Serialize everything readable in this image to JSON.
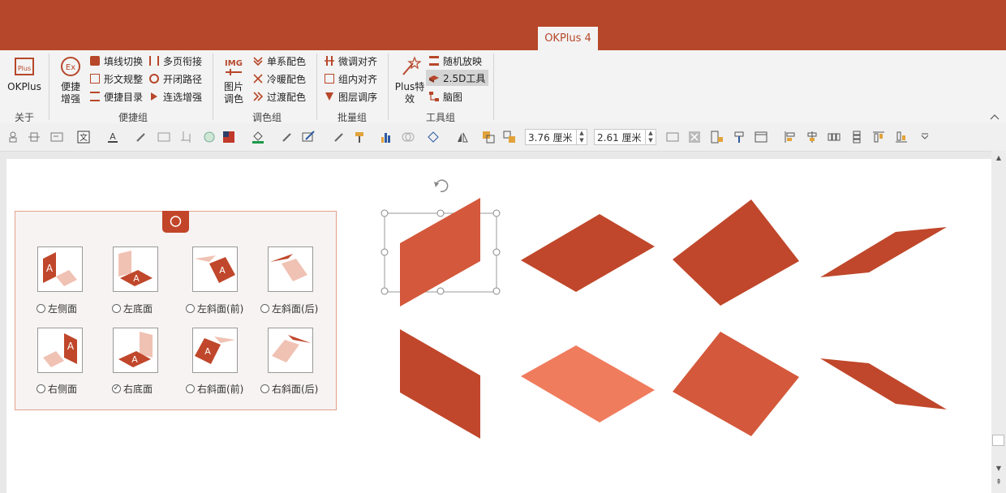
{
  "ribbon": {
    "active_tab": "OKPlus 4",
    "groups": {
      "about": {
        "label": "关于",
        "big_button": "OKPlus"
      },
      "quick": {
        "label": "便捷组",
        "big_button_l1": "便捷",
        "big_button_l2": "增强",
        "items": [
          "填线切换",
          "形文规整",
          "便捷目录",
          "多页衔接",
          "开闭路径",
          "连选增强"
        ]
      },
      "color": {
        "label": "调色组",
        "big_button_l1": "图片",
        "big_button_l2": "调色",
        "items": [
          "单系配色",
          "冷暖配色",
          "过渡配色"
        ]
      },
      "batch": {
        "label": "批量组",
        "items": [
          "微调对齐",
          "组内对齐",
          "图层调序"
        ]
      },
      "tools": {
        "label": "工具组",
        "big_button_l1": "Plus特",
        "big_button_l2": "效",
        "items": [
          "随机放映",
          "2.5D工具",
          "脑图"
        ]
      }
    },
    "icon_text": {
      "ex": "Ex",
      "img": "IMG",
      "plus": "Plus"
    }
  },
  "toolbar": {
    "width_value": "3.76 厘米",
    "height_value": "2.61 厘米"
  },
  "panel": {
    "options": [
      {
        "label": "左侧面",
        "checked": false
      },
      {
        "label": "左底面",
        "checked": false
      },
      {
        "label": "左斜面(前)",
        "checked": false
      },
      {
        "label": "左斜面(后)",
        "checked": false
      },
      {
        "label": "右侧面",
        "checked": false
      },
      {
        "label": "右底面",
        "checked": true
      },
      {
        "label": "右斜面(前)",
        "checked": false
      },
      {
        "label": "右斜面(后)",
        "checked": false
      }
    ],
    "thumb_letter": "A"
  },
  "colors": {
    "brand": "#b7472a",
    "shape_dark": "#c0472b",
    "shape_mid": "#d4583b",
    "shape_light": "#f07c5e",
    "thumb_light": "#f0c2b4"
  }
}
